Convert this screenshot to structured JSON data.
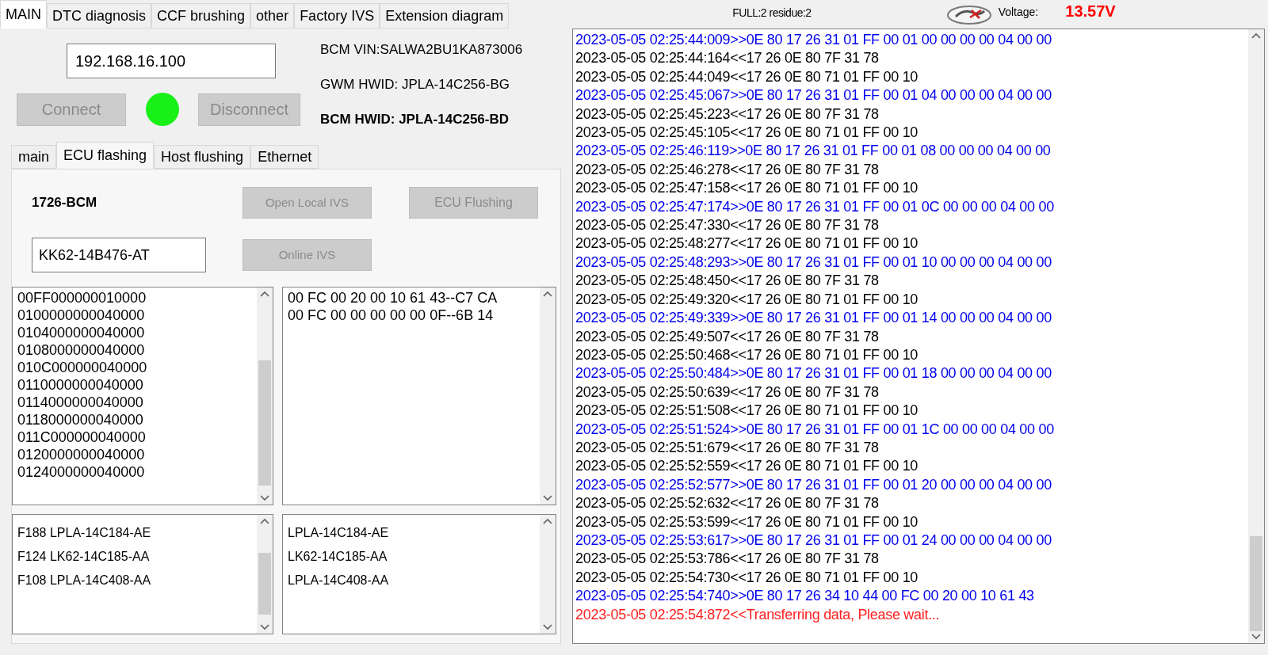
{
  "main_tabs": [
    {
      "label": "MAIN",
      "selected": true
    },
    {
      "label": "DTC diagnosis",
      "selected": false
    },
    {
      "label": "CCF brushing",
      "selected": false
    },
    {
      "label": "other",
      "selected": false
    },
    {
      "label": "Factory IVS",
      "selected": false
    },
    {
      "label": "Extension diagram",
      "selected": false
    }
  ],
  "status": {
    "counts": "FULL:2 residue:2",
    "voltage_label": "Voltage:",
    "voltage": "13.57V"
  },
  "connection": {
    "ip": "192.168.16.100",
    "connect": "Connect",
    "disconnect": "Disconnect",
    "connected": true
  },
  "info": [
    {
      "text": "BCM VIN:SALWA2BU1KA873006",
      "bold": false
    },
    {
      "text": "GWM HWID: JPLA-14C256-BG",
      "bold": false
    },
    {
      "text": "BCM HWID: JPLA-14C256-BD",
      "bold": true
    }
  ],
  "sub_tabs": [
    {
      "label": "main",
      "selected": false
    },
    {
      "label": "ECU flashing",
      "selected": true
    },
    {
      "label": "Host flushing",
      "selected": false
    },
    {
      "label": "Ethernet",
      "selected": false
    }
  ],
  "ecu": {
    "module": "1726-BCM",
    "part_number": "KK62-14B476-AT",
    "open_local": "Open Local IVS",
    "flashing": "ECU Flushing",
    "online": "Online IVS"
  },
  "blocks": [
    "00FF000000010000",
    "0100000000040000",
    "0104000000040000",
    "0108000000040000",
    "010C000000040000",
    "0110000000040000",
    "0114000000040000",
    "0118000000040000",
    "011C000000040000",
    "0120000000040000",
    "0124000000040000"
  ],
  "checksums": [
    "00 FC 00 20 00 10 61 43--C7 CA",
    "00 FC 00 00 00 00 00 0F--6B 14"
  ],
  "dids": [
    "F188  LPLA-14C184-AE",
    "F124  LK62-14C185-AA",
    "F108  LPLA-14C408-AA"
  ],
  "parts": [
    "LPLA-14C184-AE",
    "LK62-14C185-AA",
    "LPLA-14C408-AA"
  ],
  "log": [
    {
      "kind": "tx",
      "text": "2023-05-05 02:25:44:009>>0E 80 17 26 31 01 FF 00 01 00 00 00 00 04 00 00"
    },
    {
      "kind": "rx",
      "text": "2023-05-05 02:25:44:164<<17 26 0E 80 7F 31 78"
    },
    {
      "kind": "rx",
      "text": "2023-05-05 02:25:44:049<<17 26 0E 80 71 01 FF 00 10"
    },
    {
      "kind": "tx",
      "text": "2023-05-05 02:25:45:067>>0E 80 17 26 31 01 FF 00 01 04 00 00 00 04 00 00"
    },
    {
      "kind": "rx",
      "text": "2023-05-05 02:25:45:223<<17 26 0E 80 7F 31 78"
    },
    {
      "kind": "rx",
      "text": "2023-05-05 02:25:45:105<<17 26 0E 80 71 01 FF 00 10"
    },
    {
      "kind": "tx",
      "text": "2023-05-05 02:25:46:119>>0E 80 17 26 31 01 FF 00 01 08 00 00 00 04 00 00"
    },
    {
      "kind": "rx",
      "text": "2023-05-05 02:25:46:278<<17 26 0E 80 7F 31 78"
    },
    {
      "kind": "rx",
      "text": "2023-05-05 02:25:47:158<<17 26 0E 80 71 01 FF 00 10"
    },
    {
      "kind": "tx",
      "text": "2023-05-05 02:25:47:174>>0E 80 17 26 31 01 FF 00 01 0C 00 00 00 04 00 00"
    },
    {
      "kind": "rx",
      "text": "2023-05-05 02:25:47:330<<17 26 0E 80 7F 31 78"
    },
    {
      "kind": "rx",
      "text": "2023-05-05 02:25:48:277<<17 26 0E 80 71 01 FF 00 10"
    },
    {
      "kind": "tx",
      "text": "2023-05-05 02:25:48:293>>0E 80 17 26 31 01 FF 00 01 10 00 00 00 04 00 00"
    },
    {
      "kind": "rx",
      "text": "2023-05-05 02:25:48:450<<17 26 0E 80 7F 31 78"
    },
    {
      "kind": "rx",
      "text": "2023-05-05 02:25:49:320<<17 26 0E 80 71 01 FF 00 10"
    },
    {
      "kind": "tx",
      "text": "2023-05-05 02:25:49:339>>0E 80 17 26 31 01 FF 00 01 14 00 00 00 04 00 00"
    },
    {
      "kind": "rx",
      "text": "2023-05-05 02:25:49:507<<17 26 0E 80 7F 31 78"
    },
    {
      "kind": "rx",
      "text": "2023-05-05 02:25:50:468<<17 26 0E 80 71 01 FF 00 10"
    },
    {
      "kind": "tx",
      "text": "2023-05-05 02:25:50:484>>0E 80 17 26 31 01 FF 00 01 18 00 00 00 04 00 00"
    },
    {
      "kind": "rx",
      "text": "2023-05-05 02:25:50:639<<17 26 0E 80 7F 31 78"
    },
    {
      "kind": "rx",
      "text": "2023-05-05 02:25:51:508<<17 26 0E 80 71 01 FF 00 10"
    },
    {
      "kind": "tx",
      "text": "2023-05-05 02:25:51:524>>0E 80 17 26 31 01 FF 00 01 1C 00 00 00 04 00 00"
    },
    {
      "kind": "rx",
      "text": "2023-05-05 02:25:51:679<<17 26 0E 80 7F 31 78"
    },
    {
      "kind": "rx",
      "text": "2023-05-05 02:25:52:559<<17 26 0E 80 71 01 FF 00 10"
    },
    {
      "kind": "tx",
      "text": "2023-05-05 02:25:52:577>>0E 80 17 26 31 01 FF 00 01 20 00 00 00 04 00 00"
    },
    {
      "kind": "rx",
      "text": "2023-05-05 02:25:52:632<<17 26 0E 80 7F 31 78"
    },
    {
      "kind": "rx",
      "text": "2023-05-05 02:25:53:599<<17 26 0E 80 71 01 FF 00 10"
    },
    {
      "kind": "tx",
      "text": "2023-05-05 02:25:53:617>>0E 80 17 26 31 01 FF 00 01 24 00 00 00 04 00 00"
    },
    {
      "kind": "rx",
      "text": "2023-05-05 02:25:53:786<<17 26 0E 80 7F 31 78"
    },
    {
      "kind": "rx",
      "text": "2023-05-05 02:25:54:730<<17 26 0E 80 71 01 FF 00 10"
    },
    {
      "kind": "tx",
      "text": "2023-05-05 02:25:54:740>>0E 80 17 26 34 10 44 00 FC 00 20 00 10 61 43"
    },
    {
      "kind": "info",
      "text": "2023-05-05 02:25:54:872<<Transferring data, Please wait..."
    }
  ]
}
